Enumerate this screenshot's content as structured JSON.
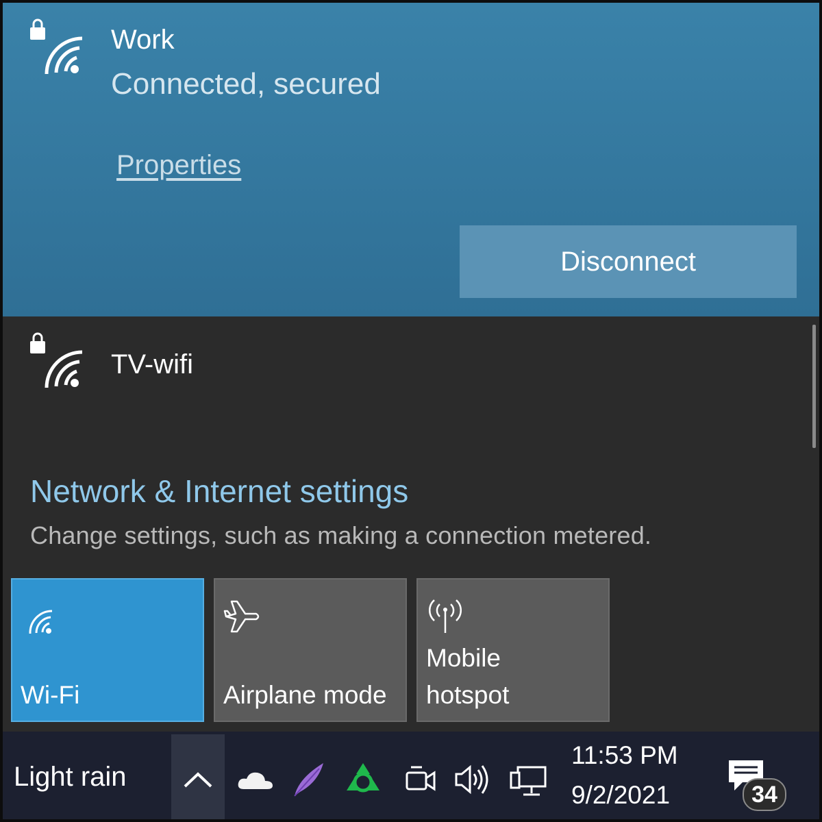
{
  "networks": [
    {
      "name": "Work",
      "status": "Connected, secured",
      "properties_label": "Properties",
      "action_label": "Disconnect"
    },
    {
      "name": "TV-wifi"
    }
  ],
  "settings": {
    "title": "Network & Internet settings",
    "subtitle": "Change settings, such as making a connection metered."
  },
  "quick_actions": [
    {
      "label": "Wi-Fi",
      "icon": "wifi-icon",
      "state": "on"
    },
    {
      "label": "Airplane mode",
      "icon": "airplane-icon",
      "state": "off"
    },
    {
      "label_line1": "Mobile",
      "label_line2": "hotspot",
      "icon": "hotspot-icon",
      "state": "off"
    }
  ],
  "taskbar": {
    "weather": "Light rain",
    "time": "11:53 PM",
    "date": "9/2/2021",
    "notification_count": "34",
    "tray_icons": [
      "chevron-up-icon",
      "onedrive-icon",
      "feather-icon",
      "sync-app-icon",
      "meet-now-icon",
      "volume-icon",
      "network-icon",
      "action-center-icon"
    ]
  },
  "colors": {
    "active_network_bg": "#3a82a9",
    "panel_bg": "#2b2b2b",
    "link_blue": "#8fc8ea",
    "wifi_tile_bg": "#2f94d0",
    "tile_off_bg": "#5b5b5b",
    "taskbar_bg": "#1c2030"
  }
}
